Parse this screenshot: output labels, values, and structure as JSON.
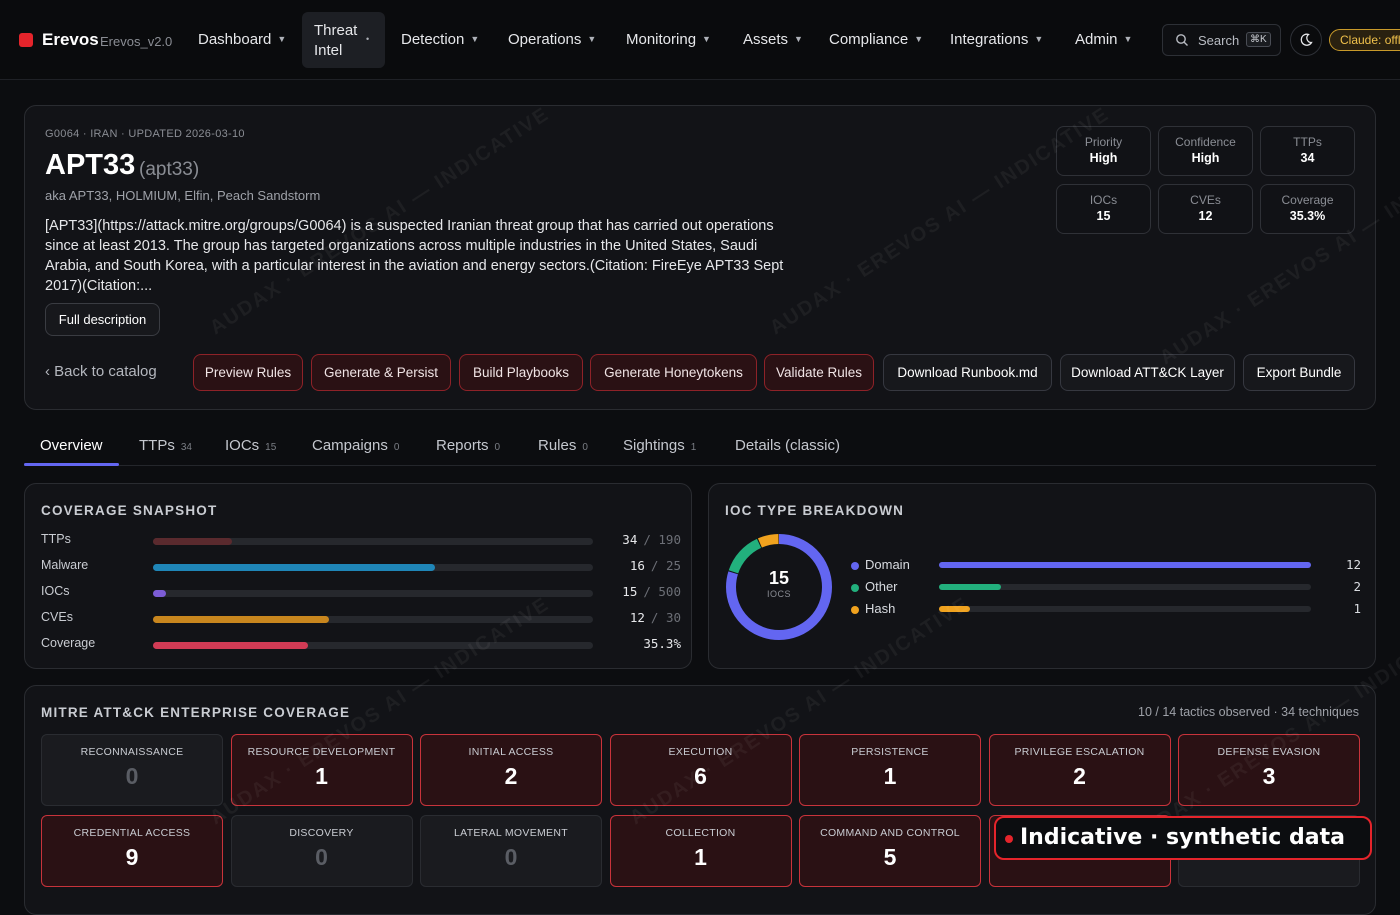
{
  "brand": {
    "name": "Erevos",
    "version": "Erevos_v2.0",
    "logo_color": "#e5242b"
  },
  "nav": [
    {
      "label": "Dashboard"
    },
    {
      "label_line1": "Threat",
      "label_line2": "Intel",
      "active": true
    },
    {
      "label": "Detection"
    },
    {
      "label": "Operations"
    },
    {
      "label": "Monitoring"
    },
    {
      "label": "Assets"
    },
    {
      "label": "Compliance"
    },
    {
      "label": "Integrations"
    },
    {
      "label": "Admin"
    }
  ],
  "search": {
    "placeholder": "Search",
    "shortcut": "⌘K"
  },
  "claude_status": "Claude: offline",
  "actor": {
    "meta": "G0064 · IRAN · UPDATED 2026-03-10",
    "name": "APT33",
    "slug": "(apt33)",
    "aka": "aka APT33, HOLMIUM, Elfin, Peach Sandstorm",
    "description": "[APT33](https://attack.mitre.org/groups/G0064) is a suspected Iranian threat group that has carried out operations since at least 2013. The group has targeted organizations across multiple industries in the United States, Saudi Arabia, and South Korea, with a particular interest in the aviation and energy sectors.(Citation: FireEye APT33 Sept 2017)(Citation:...",
    "full_description_label": "Full description",
    "back_label": "‹ Back to catalog"
  },
  "stats": [
    {
      "label": "Priority",
      "value": "High"
    },
    {
      "label": "Confidence",
      "value": "High"
    },
    {
      "label": "TTPs",
      "value": "34"
    },
    {
      "label": "IOCs",
      "value": "15"
    },
    {
      "label": "CVEs",
      "value": "12"
    },
    {
      "label": "Coverage",
      "value": "35.3%"
    }
  ],
  "actions": [
    {
      "label": "Preview Rules",
      "style": "red"
    },
    {
      "label": "Generate & Persist",
      "style": "red"
    },
    {
      "label": "Build Playbooks",
      "style": "red"
    },
    {
      "label": "Generate Honeytokens",
      "style": "red"
    },
    {
      "label": "Validate Rules",
      "style": "red"
    },
    {
      "label": "Download Runbook.md",
      "style": "gray"
    },
    {
      "label": "Download ATT&CK Layer",
      "style": "gray"
    },
    {
      "label": "Export Bundle",
      "style": "gray"
    }
  ],
  "tabs": [
    {
      "label": "Overview",
      "count": ""
    },
    {
      "label": "TTPs",
      "count": "34"
    },
    {
      "label": "IOCs",
      "count": "15"
    },
    {
      "label": "Campaigns",
      "count": "0"
    },
    {
      "label": "Reports",
      "count": "0"
    },
    {
      "label": "Rules",
      "count": "0"
    },
    {
      "label": "Sightings",
      "count": "1"
    },
    {
      "label": "Details (classic)",
      "count": ""
    }
  ],
  "coverage": {
    "title": "COVERAGE SNAPSHOT",
    "rows": [
      {
        "label": "TTPs",
        "value": "34",
        "denom": "/ 190",
        "fraction": 0.179,
        "color": "#5a2a2e"
      },
      {
        "label": "Malware",
        "value": "16",
        "denom": "/ 25",
        "fraction": 0.64,
        "color": "#1f86b8"
      },
      {
        "label": "IOCs",
        "value": "15",
        "denom": "/ 500",
        "fraction": 0.03,
        "color": "#7c5cd6"
      },
      {
        "label": "CVEs",
        "value": "12",
        "denom": "/ 30",
        "fraction": 0.4,
        "color": "#c8861e"
      },
      {
        "label": "Coverage",
        "value": "35.3%",
        "denom": "",
        "fraction": 0.353,
        "color": "#d23b55"
      }
    ]
  },
  "ioc_breakdown": {
    "title": "IOC TYPE BREAKDOWN",
    "total": "15",
    "unit": "IOCS",
    "items": [
      {
        "label": "Domain",
        "count": 12,
        "display": "12",
        "color": "#6366f1"
      },
      {
        "label": "Other",
        "count": 2,
        "display": "2",
        "color": "#22b07d"
      },
      {
        "label": "Hash",
        "count": 1,
        "display": "1",
        "color": "#f0a21e"
      }
    ]
  },
  "mitre": {
    "title": "MITRE ATT&CK ENTERPRISE COVERAGE",
    "summary": "10 / 14 tactics observed · 34 techniques",
    "tactics": [
      {
        "name": "RECONNAISSANCE",
        "count": "0"
      },
      {
        "name": "RESOURCE DEVELOPMENT",
        "count": "1"
      },
      {
        "name": "INITIAL ACCESS",
        "count": "2"
      },
      {
        "name": "EXECUTION",
        "count": "6"
      },
      {
        "name": "PERSISTENCE",
        "count": "1"
      },
      {
        "name": "PRIVILEGE ESCALATION",
        "count": "2"
      },
      {
        "name": "DEFENSE EVASION",
        "count": "3"
      },
      {
        "name": "CREDENTIAL ACCESS",
        "count": "9"
      },
      {
        "name": "DISCOVERY",
        "count": "0"
      },
      {
        "name": "LATERAL MOVEMENT",
        "count": "0"
      },
      {
        "name": "COLLECTION",
        "count": "1"
      },
      {
        "name": "COMMAND AND CONTROL",
        "count": "5"
      },
      {
        "name": "",
        "count": "1"
      },
      {
        "name": "",
        "count": "0"
      }
    ]
  },
  "banner": "Indicative · synthetic data",
  "watermark": "AUDAX · EREVOS AI — INDICATIVE"
}
